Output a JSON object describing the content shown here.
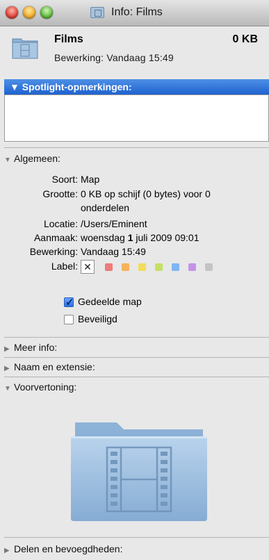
{
  "window": {
    "title": "Info: Films"
  },
  "header": {
    "name": "Films",
    "size": "0 KB",
    "modified": "Bewerking:  Vandaag 15:49"
  },
  "sections": {
    "spotlight": "▼ Spotlight-opmerkingen:",
    "general": "Algemeen:",
    "more_info": "Meer info:",
    "name_ext": "Naam en extensie:",
    "preview": "Voorvertoning:",
    "sharing": "Delen en bevoegdheden:"
  },
  "general": {
    "kind_label": "Soort:",
    "kind_value": "Map",
    "size_label": "Grootte:",
    "size_value_line1": "0 KB op schijf (0 bytes) voor 0",
    "size_value_line2": "onderdelen",
    "where_label": "Locatie:",
    "where_value": "/Users/Eminent",
    "created_label": "Aanmaak:",
    "created_value_pre": "woensdag",
    "created_value_bold": "1",
    "created_value_post": "juli 2009 09:01",
    "modified_label": "Bewerking:",
    "modified_value": "Vandaag 15:49",
    "label_label": "Label:",
    "label_clear": "✕",
    "label_colors": [
      "#ef7b7b",
      "#f6b35a",
      "#f2dc5c",
      "#c6e065",
      "#7fb5f3",
      "#c493e6",
      "#c4c4c4"
    ],
    "shared_folder_label": "Gedeelde map",
    "shared_folder_checked": true,
    "locked_label": "Beveiligd",
    "locked_checked": false
  },
  "colors": {
    "accent": "#2f76de",
    "window_bg": "#e8e8e8"
  }
}
